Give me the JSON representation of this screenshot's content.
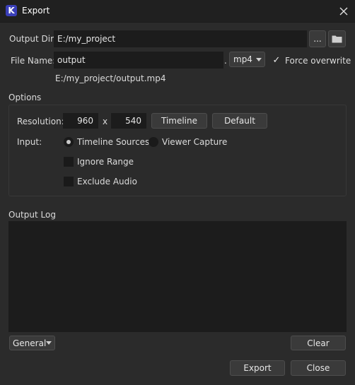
{
  "window": {
    "title": "Export"
  },
  "output_dir": {
    "label": "Output Dir:",
    "value": "E:/my_project",
    "browse_label": "..."
  },
  "file_name": {
    "label": "File Name:",
    "value": "output",
    "dot": ".",
    "format": "mp4"
  },
  "force_overwrite": {
    "label": "Force overwrite",
    "checked": true,
    "mark": "✓"
  },
  "full_path": "E:/my_project/output.mp4",
  "options": {
    "title": "Options",
    "resolution_label": "Resolution:",
    "width": "960",
    "times": "x",
    "height": "540",
    "timeline_button": "Timeline",
    "default_button": "Default",
    "input_label": "Input:",
    "radio_timeline": "Timeline Sources",
    "radio_viewer": "Viewer Capture",
    "ignore_range": "Ignore Range",
    "exclude_audio": "Exclude Audio"
  },
  "log": {
    "title": "Output Log",
    "filter": "General",
    "clear_button": "Clear"
  },
  "footer": {
    "export_button": "Export",
    "close_button": "Close"
  },
  "icons": {
    "app": "app-logo-icon",
    "close": "close-icon",
    "folder": "folder-icon",
    "dropdown": "chevron-down-icon"
  },
  "colors": {
    "background": "#2b2b2b",
    "field": "#1c1c1c",
    "titlebar": "#202020",
    "app_icon": "#3a3fb8"
  }
}
